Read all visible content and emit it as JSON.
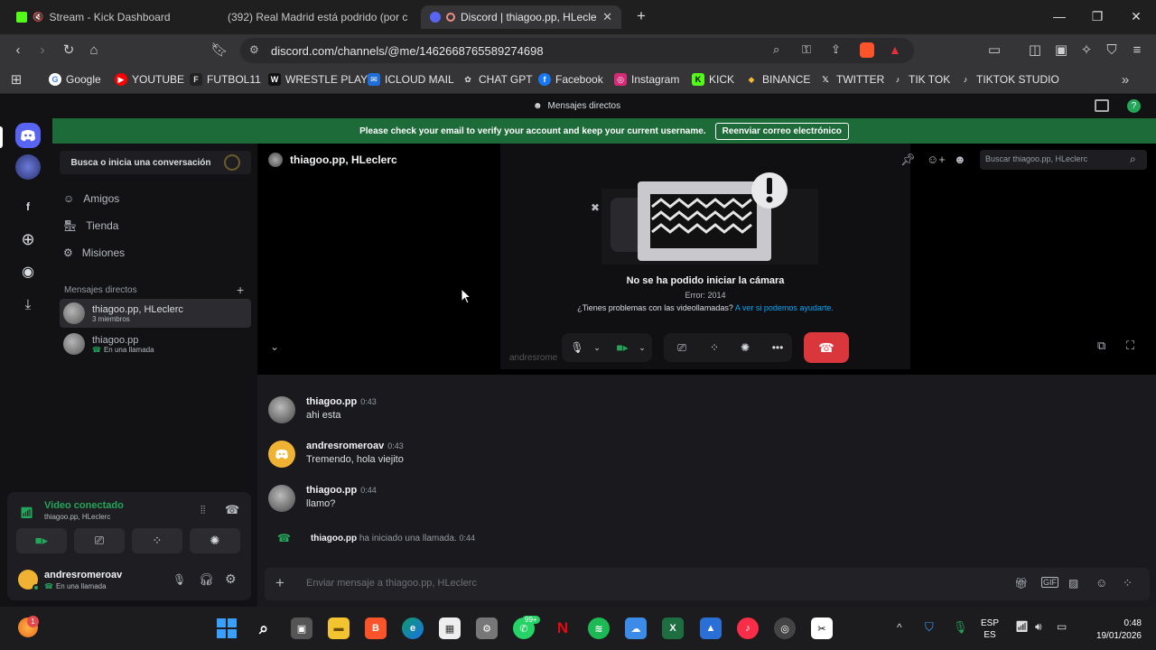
{
  "browser": {
    "tabs": [
      {
        "title": "Stream - Kick Dashboard",
        "icon": "kick-icon"
      },
      {
        "title": "(392) Real Madrid está podrido (por c",
        "icon": "youtube-icon"
      },
      {
        "title": "Discord | thiagoo.pp, HLeclerc",
        "icon": "discord-icon"
      }
    ],
    "url": "discord.com/channels/@me/1462668765589274698",
    "bookmarks": [
      "Google",
      "YOUTUBE",
      "FUTBOL11",
      "WRESTLE PLAY",
      "ICLOUD MAIL",
      "CHAT GPT",
      "Facebook",
      "Instagram",
      "KICK",
      "BINANCE",
      "TWITTER",
      "TIK TOK",
      "TIKTOK STUDIO"
    ]
  },
  "discord": {
    "topbar_title": "Mensajes directos",
    "banner": {
      "text": "Please check your email to verify your account and keep your current username.",
      "button": "Reenviar correo electrónico"
    },
    "sidebar": {
      "search": "Busca o inicia una conversación",
      "nav": [
        "Amigos",
        "Tienda",
        "Misiones"
      ],
      "dm_header": "Mensajes directos",
      "dms": [
        {
          "name": "thiagoo.pp, HLeclerc",
          "sub": "3 miembros"
        },
        {
          "name": "thiagoo.pp",
          "sub": "En una llamada"
        }
      ]
    },
    "voice": {
      "status": "Video conectado",
      "channel": "thiagoo.pp, HLeclerc"
    },
    "user": {
      "name": "andresromeroav",
      "status": "En una llamada"
    },
    "channel": {
      "title": "thiagoo.pp, HLeclerc",
      "search_placeholder": "Buscar thiagoo.pp, HLeclerc"
    },
    "call": {
      "error_title": "No se ha podido iniciar la cámara",
      "error_code": "Error: 2014",
      "help_text": "¿Tienes problemas con las videollamadas?",
      "help_link": "A ver si podemos ayudarte.",
      "tile_name": "andresrome"
    },
    "messages": [
      {
        "author": "thiagoo.pp",
        "time": "0:43",
        "text": "ahi esta"
      },
      {
        "author": "andresromeroav",
        "time": "0:43",
        "text": "Tremendo, hola viejito"
      },
      {
        "author": "thiagoo.pp",
        "time": "0:44",
        "text": "llamo?"
      }
    ],
    "system_message": {
      "author": "thiagoo.pp",
      "text": "ha iniciado una llamada.",
      "time": "0:44"
    },
    "composer_placeholder": "Enviar mensaje a thiagoo.pp, HLeclerc"
  },
  "taskbar": {
    "lang": "ESP",
    "lang2": "ES",
    "time": "0:48",
    "date": "19/01/2026",
    "whatsapp_badge": "99+",
    "notif_badge": "1"
  },
  "colors": {
    "accent_green": "#1e6b3a",
    "hangup_red": "#da373c",
    "link_blue": "#00a8fc",
    "discord_blurple": "#5865f2"
  }
}
